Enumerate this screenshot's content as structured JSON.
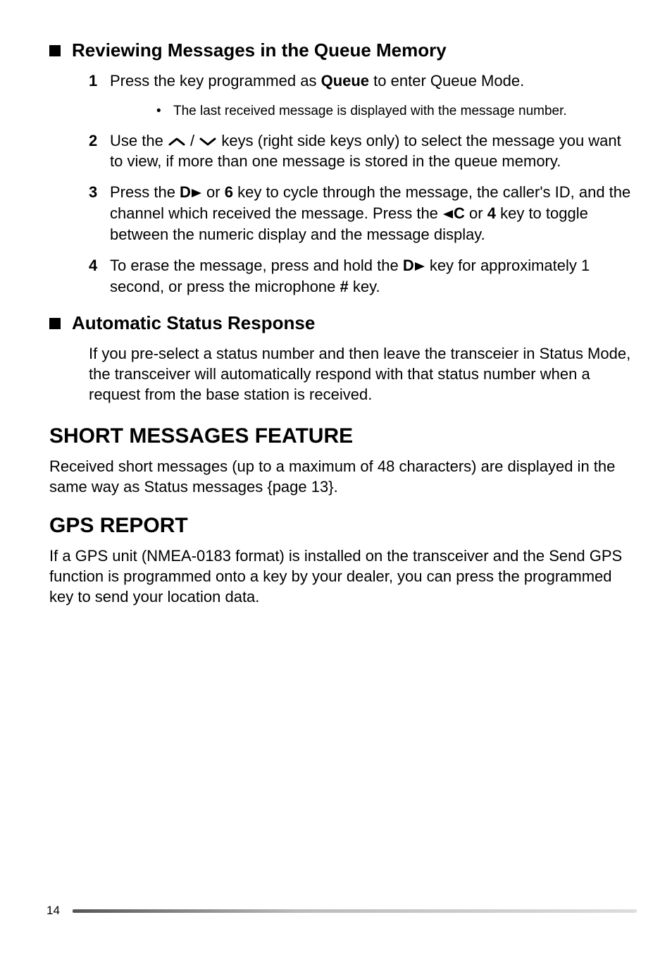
{
  "section_reviewing": {
    "title": "Reviewing Messages in the Queue Memory",
    "steps": {
      "s1": {
        "num": "1",
        "pre": "Press the key programmed as ",
        "bold": "Queue",
        "post": " to enter Queue Mode.",
        "sub_bullet": "•",
        "sub": "The last received message is displayed with the message number."
      },
      "s2": {
        "num": "2",
        "pre": "Use the ",
        "mid": " / ",
        "post": " keys (right side keys only) to select the message you want to view, if more than one message is stored in the queue memory."
      },
      "s3": {
        "num": "3",
        "pre": "Press the ",
        "dkey": "D",
        "or1": " or ",
        "six": "6",
        "mid1": " key to cycle through the message, the caller's ID, and the channel which received the message.  Press the ",
        "ckey": "C",
        "or2": " or ",
        "four": "4",
        "post": " key to toggle between the numeric display and the message display."
      },
      "s4": {
        "num": "4",
        "pre": "To erase the message, press and hold the ",
        "dkey": "D",
        "mid": " key for approximately 1 second, or press the microphone ",
        "hash": "#",
        "post": " key."
      }
    }
  },
  "section_auto": {
    "title": "Automatic Status Response",
    "para": "If you pre-select a status number and then leave the transceier in Status Mode, the transceiver will automatically respond with that status number when a request from the base station is received."
  },
  "section_short": {
    "title": "SHORT MESSAGES FEATURE",
    "para": "Received short messages (up to a maximum of 48 characters) are displayed in the same way as Status messages {page 13}."
  },
  "section_gps": {
    "title": "GPS REPORT",
    "para": "If a GPS unit (NMEA-0183 format) is installed on the transceiver and the Send GPS function is programmed onto a key by your dealer, you can press the programmed key to send your location data."
  },
  "footer": {
    "page_number": "14"
  }
}
